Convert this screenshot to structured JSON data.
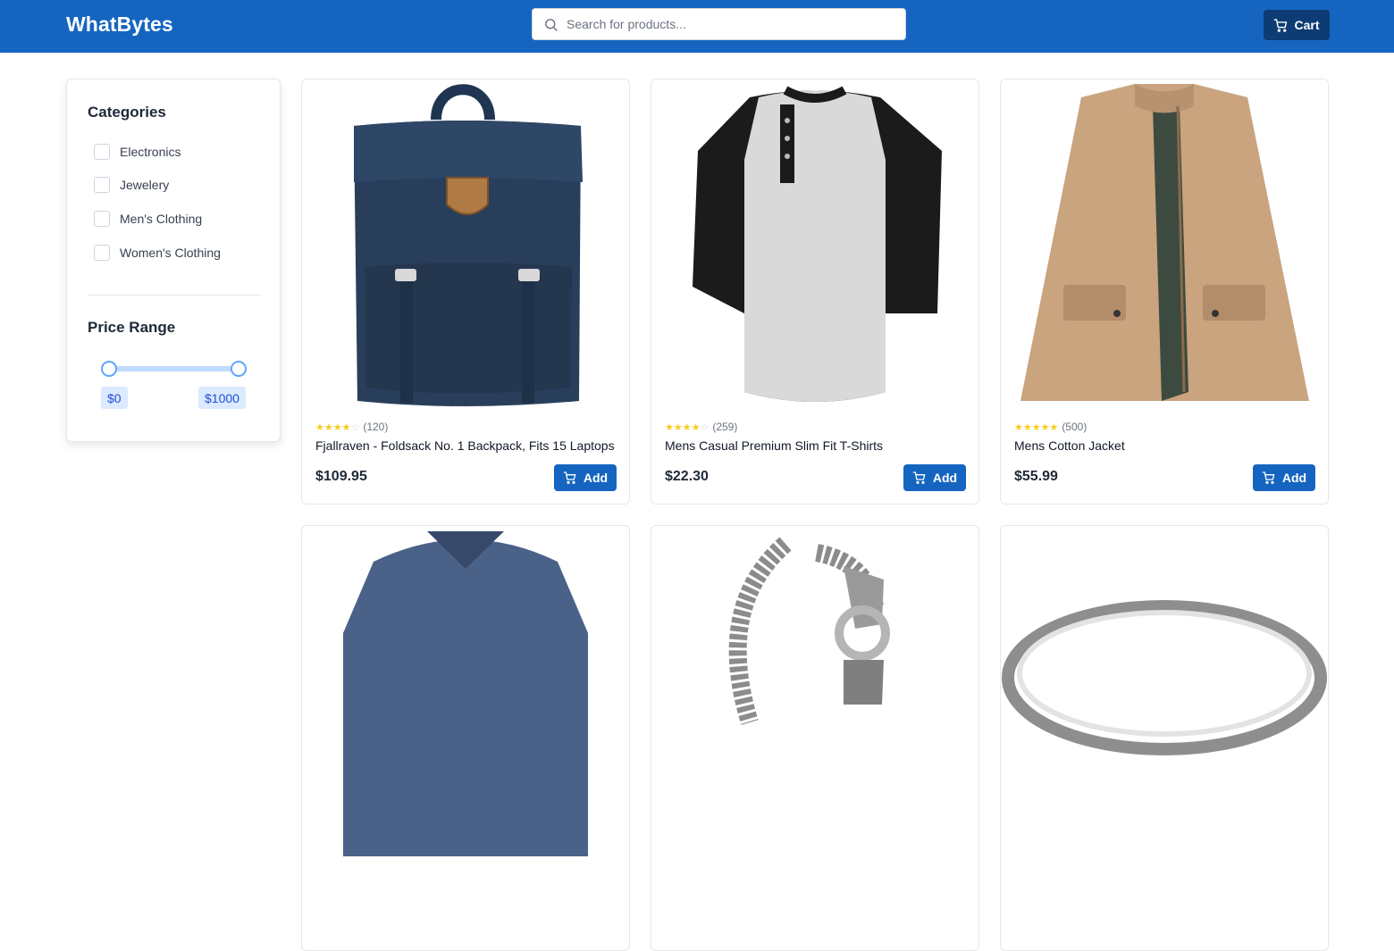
{
  "header": {
    "brand": "WhatBytes",
    "search_placeholder": "Search for products...",
    "cart_label": "Cart",
    "background_color": "#1565c0",
    "cart_button_color": "#0d3b73"
  },
  "sidebar": {
    "categories_title": "Categories",
    "categories": [
      {
        "label": "Electronics",
        "checked": false
      },
      {
        "label": "Jewelery",
        "checked": false
      },
      {
        "label": "Men's Clothing",
        "checked": false
      },
      {
        "label": "Women's Clothing",
        "checked": false
      }
    ],
    "price_title": "Price Range",
    "price_min": "$0",
    "price_max": "$1000"
  },
  "products": [
    {
      "rating_stars": 4,
      "rating_count": "(120)",
      "title": "Fjallraven - Foldsack No. 1 Backpack, Fits 15 Laptops",
      "price": "$109.95",
      "add_label": "Add",
      "image": "backpack"
    },
    {
      "rating_stars": 4,
      "rating_count": "(259)",
      "title": "Mens Casual Premium Slim Fit T-Shirts",
      "price": "$22.30",
      "add_label": "Add",
      "image": "henley-shirt"
    },
    {
      "rating_stars": 5,
      "rating_count": "(500)",
      "title": "Mens Cotton Jacket",
      "price": "$55.99",
      "add_label": "Add",
      "image": "jacket"
    },
    {
      "image": "v-neck-shirt"
    },
    {
      "image": "dragon-bracelet"
    },
    {
      "image": "silver-ring"
    }
  ]
}
